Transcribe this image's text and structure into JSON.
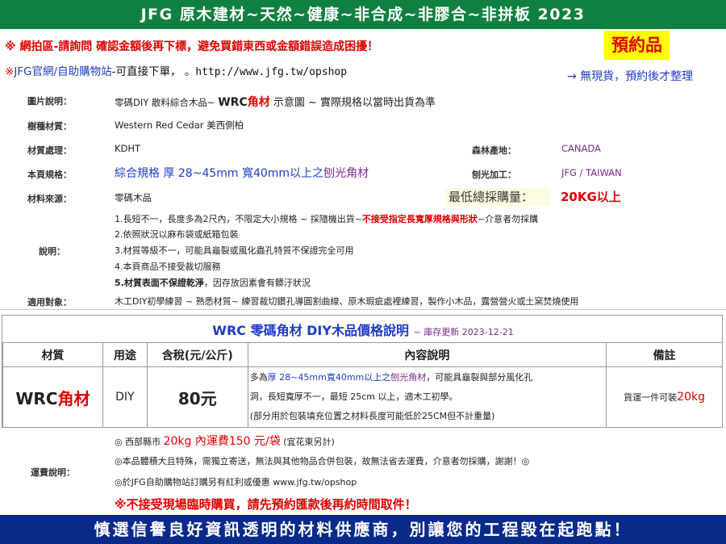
{
  "header": {
    "title": "JFG 原木建材~天然~健康~非合成~非膠合~非拼板 2023"
  },
  "notices": {
    "auction": "※ 網拍區-請詢問 確認金額後再下標，避免買錯東西或金額錯誤造成困擾！",
    "shop_prefix": "※",
    "shop_name": "JFG官網/自助購物站",
    "shop_text": "-可直接下單，",
    "shop_dot": "。",
    "shop_url": "http://www.jfg.tw/opshop",
    "preorder": "預約品",
    "no_stock": "→ 無現貨，預約後才整理"
  },
  "specs": {
    "image_label": "圖片說明：",
    "image_value_a": "零碼DIY 散料綜合木品~",
    "image_value_b": "WRC",
    "image_value_c": "角材",
    "image_value_d": " 示意圖 ~ 實際規格以當時出貨為準",
    "species_label": "樹種材質：",
    "species_value": "Western Red Cedar 美西側柏",
    "treatment_label": "材質處理：",
    "treatment_value": "KDHT",
    "origin_label": "森林產地：",
    "origin_value": "CANADA",
    "size_label": "本頁規格：",
    "size_value_a": "綜合規格 厚 28~45mm 寬40mm以上之",
    "size_value_b": "刨光角材",
    "planing_label": "刨光加工：",
    "planing_value": "JFG / TAIWAN",
    "source_label": "材料來源：",
    "source_value": "零碼木品",
    "min_buy_label": "最低總採購量：",
    "min_buy_value": "20KG以上",
    "desc_label": "說明：",
    "desc_1a": "1.長短不一，長度多為2尺內，不限定大小規格 ~ 採隨機出貨~",
    "desc_1b": "不接受指定長寬厚規格與形狀",
    "desc_1c": "~介意者勿採購",
    "desc_2": "2.依照狀況以麻布袋或紙箱包裝",
    "desc_3": "3.材質等級不一，可能具龜裂或風化蟲孔特質不保證完全可用",
    "desc_4": "4.本頁商品不接受裁切服務",
    "desc_5a": "5.材質表面不保證乾淨",
    "desc_5b": "，因存放因素會有髒汙狀況",
    "usage_label": "適用對象：",
    "usage_value": "木工DIY初學練習 ~ 熟悉材質~ 練習裁切鑽孔導圓割曲線、原木瑕疵處裡練習，製作小木品，露營營火或土窯焚燒使用"
  },
  "price": {
    "title": "WRC 零碼角材 DIY木品價格說明",
    "updated": "~ 庫存更新 2023-12-21",
    "headers": [
      "材質",
      "用途",
      "含稅(元/公斤)",
      "內容說明",
      "備註"
    ],
    "material_a": "WRC",
    "material_b": "角材",
    "use": "DIY",
    "price": "80元",
    "content_1a": "多為",
    "content_1b": "厚 28~45mm寬40mm以上之",
    "content_1c": "刨光角材",
    "content_1d": "，可能具龜裂與部分風化孔",
    "content_2": "洞，長短寬厚不一，最短 25cm 以上，適木工初學。",
    "content_3": "(部分用於包裝填充位置之材料長度可能低於25CM但不計重量)",
    "note_a": "貨運一件可裝",
    "note_b": "20kg"
  },
  "shipping": {
    "label": "運費說明：",
    "line1_a": "◎ 西部縣市 ",
    "line1_b": "20kg 內運費150 元/袋",
    "line1_c": " (宜花東另計)",
    "line2": "◎本品體積大且特殊，需獨立寄送，無法與其他物品合併包裝，故無法省去運費，介意者勿採購，謝謝！◎",
    "line3": "◎於JFG自助購物站訂購另有紅利或優惠 www.jfg.tw/opshop",
    "warning": "※不接受現場臨時購買，請先預約匯款後再約時間取件！"
  },
  "footer": {
    "slogan": "慎選信譽良好資訊透明的材料供應商，別讓您的工程毀在起跑點！"
  }
}
